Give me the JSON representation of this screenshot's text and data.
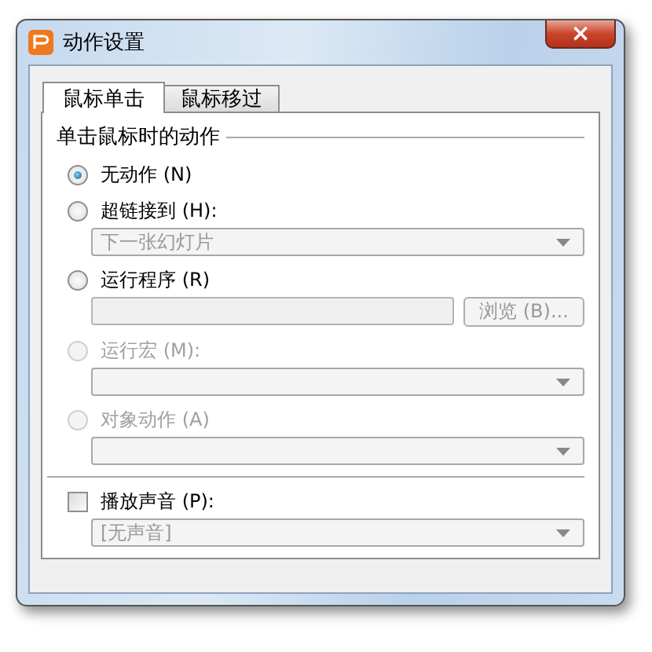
{
  "window": {
    "title": "动作设置",
    "close": "×"
  },
  "tabs": [
    {
      "label": "鼠标单击",
      "selected": true
    },
    {
      "label": "鼠标移过",
      "selected": false
    }
  ],
  "group_title": "单击鼠标时的动作",
  "actions": [
    {
      "label": "无动作 (N)",
      "selected": true,
      "disabled": false
    },
    {
      "label": "超链接到 (H):",
      "selected": false,
      "disabled": false,
      "field": {
        "kind": "dropdown",
        "value": "下一张幻灯片",
        "disabled": true
      }
    },
    {
      "label": "运行程序 (R)",
      "selected": false,
      "disabled": false,
      "field": {
        "kind": "text_with_button",
        "button": "浏览 (B)...",
        "disabled": true
      }
    },
    {
      "label": "运行宏 (M):",
      "selected": false,
      "disabled": true,
      "field": {
        "kind": "dropdown",
        "disabled": true
      }
    },
    {
      "label": "对象动作 (A)",
      "selected": false,
      "disabled": true,
      "field": {
        "kind": "dropdown",
        "disabled": true
      }
    }
  ],
  "sound": {
    "label": "播放声音 (P):",
    "checked": false,
    "field": {
      "kind": "dropdown",
      "value": "[无声音]",
      "disabled": true
    }
  }
}
